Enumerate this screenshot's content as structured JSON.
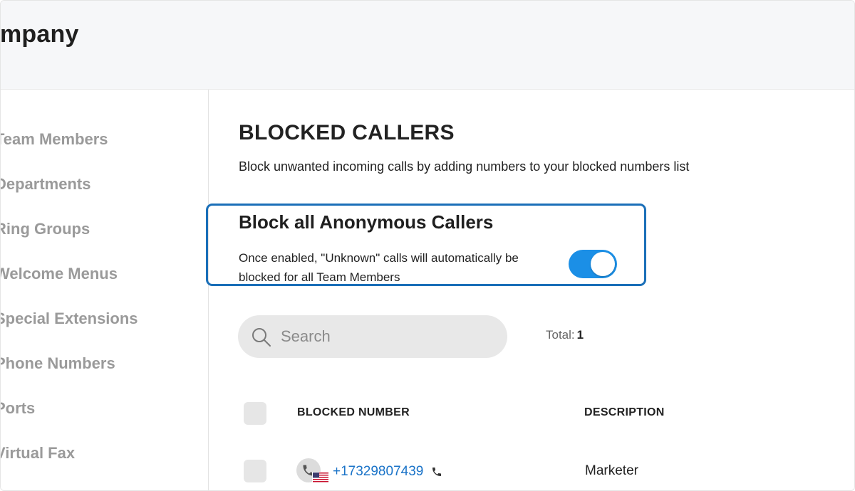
{
  "header": {
    "title": "ompany"
  },
  "sidebar": {
    "items": [
      {
        "label": "Team Members"
      },
      {
        "label": "Departments"
      },
      {
        "label": "Ring Groups"
      },
      {
        "label": "Welcome Menus"
      },
      {
        "label": "Special Extensions"
      },
      {
        "label": "Phone Numbers"
      },
      {
        "label": "Ports"
      },
      {
        "label": "Virtual Fax"
      }
    ]
  },
  "main": {
    "title": "BLOCKED CALLERS",
    "subtitle": "Block unwanted incoming calls by adding numbers to your blocked numbers list",
    "anonymous": {
      "title": "Block all Anonymous Callers",
      "description": "Once enabled, \"Unknown\" calls will automatically be blocked for all Team Members",
      "enabled": true
    },
    "search": {
      "placeholder": "Search",
      "value": ""
    },
    "total": {
      "label": "Total:",
      "count": "1"
    },
    "table": {
      "columns": [
        "BLOCKED NUMBER",
        "DESCRIPTION"
      ],
      "rows": [
        {
          "number": "+17329807439",
          "description": "Marketer",
          "country": "US"
        }
      ]
    }
  },
  "colors": {
    "accent": "#1b8fe6",
    "highlight_border": "#1a6fb8",
    "link": "#1a73c8",
    "sidebar_text": "#9a9a9a"
  },
  "icons": {
    "search": "search-icon",
    "phone": "phone-icon",
    "flag": "us-flag-icon"
  }
}
